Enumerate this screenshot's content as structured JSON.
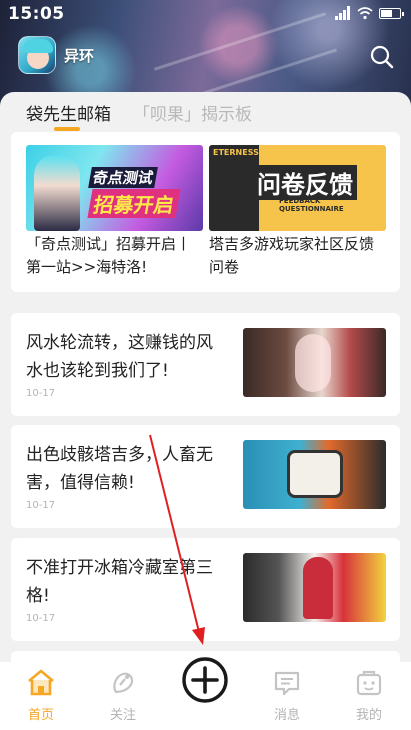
{
  "status_bar": {
    "time": "15:05"
  },
  "header": {
    "app_name": "异环"
  },
  "tabs": [
    {
      "label": "袋先生邮箱",
      "active": true
    },
    {
      "label": "「呗果」揭示板",
      "active": false
    }
  ],
  "notices": [
    {
      "title": "「奇点测试」招募开启丨第一站>>海特洛!",
      "image_text_1": "奇点测试",
      "image_text_2": "招募开启"
    },
    {
      "title": "塔吉多游戏玩家社区反馈问卷",
      "image_text_1": "问卷反馈",
      "image_subtext": "FEEDBACK QUESTIONNAIRE",
      "image_caption": "ETERNESS"
    }
  ],
  "posts": [
    {
      "title": "风水轮流转，这赚钱的风水也该轮到我们了!",
      "date": "10-17"
    },
    {
      "title": "出色歧骸塔吉多，人畜无害，值得信赖!",
      "date": "10-17"
    },
    {
      "title": "不准打开冰箱冷藏室第三格!",
      "date": "10-17"
    }
  ],
  "bottom_nav": [
    {
      "label": "首页",
      "icon": "home-icon",
      "active": true
    },
    {
      "label": "关注",
      "icon": "follow-icon",
      "active": false
    },
    {
      "label": "消息",
      "icon": "message-icon",
      "active": false
    },
    {
      "label": "我的",
      "icon": "profile-icon",
      "active": false
    }
  ],
  "colors": {
    "accent": "#f5a623",
    "annotation_arrow": "#e02020"
  }
}
